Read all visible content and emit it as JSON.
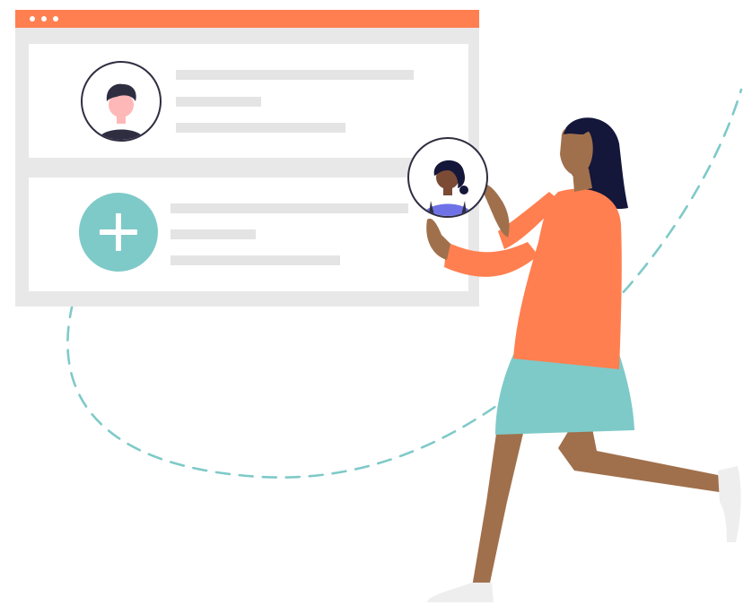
{
  "colors": {
    "accent": "#ff7f50",
    "teal": "#7ecac8",
    "window_gray": "#e8e8e8",
    "placeholder_gray": "#e4e4e4",
    "skin": "#a0704c",
    "hair": "#14163a",
    "avatar_shirt": "#6f72e6",
    "shoe": "#eeeeee"
  },
  "window": {
    "title_dots": 3,
    "cards": [
      {
        "type": "user-profile",
        "placeholder_lines": 3
      },
      {
        "type": "add-user",
        "placeholder_lines": 3
      }
    ]
  },
  "icons": {
    "add": "plus-icon",
    "user_avatar": "male-user-avatar",
    "held_avatar": "female-user-avatar"
  }
}
